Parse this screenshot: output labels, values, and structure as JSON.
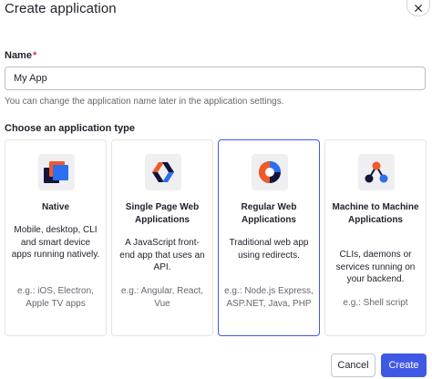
{
  "dialog": {
    "title": "Create application"
  },
  "name_field": {
    "label": "Name",
    "required_mark": "*",
    "value": "My App",
    "hint": "You can change the application name later in the application settings."
  },
  "app_type": {
    "label": "Choose an application type",
    "cards": [
      {
        "title": "Native",
        "description": "Mobile, desktop, CLI and smart device apps running natively.",
        "examples": "e.g.: iOS, Electron, Apple TV apps",
        "icon": "native-app-icon",
        "selected": false
      },
      {
        "title": "Single Page Web Applications",
        "description": "A JavaScript front-end app that uses an API.",
        "examples": "e.g.: Angular, React, Vue",
        "icon": "spa-icon",
        "selected": false
      },
      {
        "title": "Regular Web Applications",
        "description": "Traditional web app using redirects.",
        "examples": "e.g.: Node.js Express, ASP.NET, Java, PHP",
        "icon": "regular-web-app-icon",
        "selected": true
      },
      {
        "title": "Machine to Machine Applications",
        "description": "CLIs, daemons or services running on your backend.",
        "examples": "e.g.: Shell script",
        "icon": "machine-to-machine-icon",
        "selected": false
      }
    ]
  },
  "footer": {
    "cancel_label": "Cancel",
    "create_label": "Create"
  },
  "colors": {
    "accent": "#3f59e4",
    "required": "#d03c38",
    "icon_orange": "#f05a28",
    "icon_blue": "#2d6ef0",
    "icon_navy": "#13153b"
  }
}
